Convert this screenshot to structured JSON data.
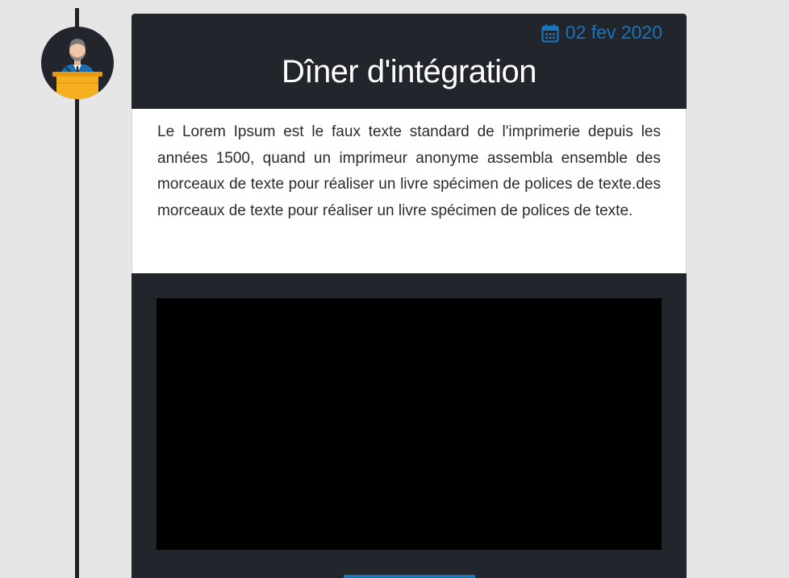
{
  "event": {
    "date": "02 fev 2020",
    "title": "Dîner d'intégration",
    "description": "Le Lorem Ipsum est le faux texte standard de l'imprimerie depuis les années 1500, quand un imprimeur anonyme assembla ensemble des morceaux de texte pour réaliser un livre spécimen de polices de texte.des morceaux de texte pour réaliser un livre spécimen de polices de texte."
  },
  "icons": {
    "avatar": "speaker-at-podium-icon",
    "date": "calendar-icon"
  },
  "colors": {
    "background": "#e6e6e6",
    "card_dark": "#22252c",
    "accent_blue": "#1a74b8",
    "podium_yellow": "#f5b01f"
  }
}
